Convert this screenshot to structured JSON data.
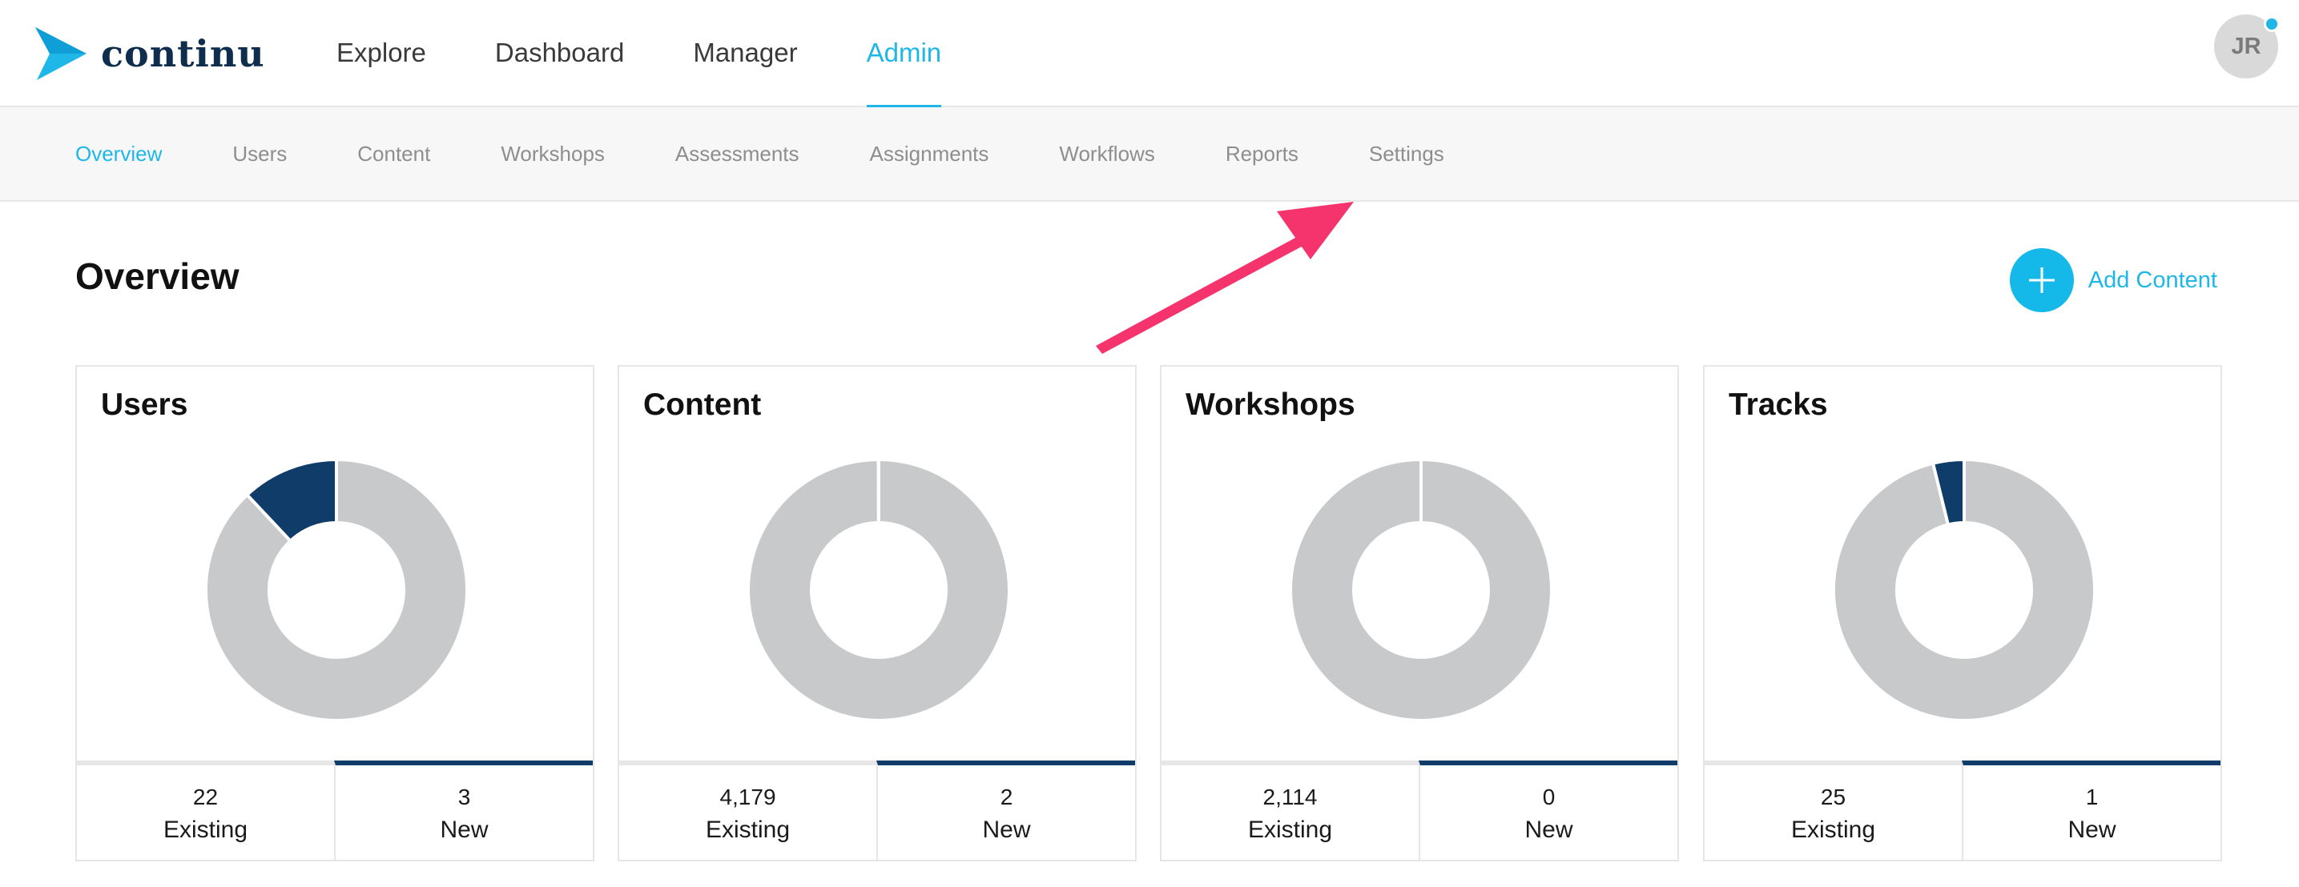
{
  "app": {
    "logo_text": "continu"
  },
  "main_nav": [
    {
      "label": "Explore",
      "active": false
    },
    {
      "label": "Dashboard",
      "active": false
    },
    {
      "label": "Manager",
      "active": false
    },
    {
      "label": "Admin",
      "active": true
    }
  ],
  "user": {
    "initials": "JR",
    "notification_color": "#1eb7e8"
  },
  "sub_nav": [
    {
      "label": "Overview",
      "active": true
    },
    {
      "label": "Users",
      "active": false
    },
    {
      "label": "Content",
      "active": false
    },
    {
      "label": "Workshops",
      "active": false
    },
    {
      "label": "Assessments",
      "active": false
    },
    {
      "label": "Assignments",
      "active": false
    },
    {
      "label": "Workflows",
      "active": false
    },
    {
      "label": "Reports",
      "active": false
    },
    {
      "label": "Settings",
      "active": false
    }
  ],
  "page": {
    "title": "Overview",
    "add_button_label": "Add Content",
    "add_icon": "plus-icon"
  },
  "colors": {
    "accent": "#1eb7e8",
    "existing": "#c8c9ca",
    "new": "#0f3c68",
    "annotation_arrow": "#f5336c"
  },
  "cards": [
    {
      "title": "Users",
      "existing_value": "22",
      "existing_label": "Existing",
      "new_value": "3",
      "new_label": "New",
      "existing": 22,
      "new": 3
    },
    {
      "title": "Content",
      "existing_value": "4,179",
      "existing_label": "Existing",
      "new_value": "2",
      "new_label": "New",
      "existing": 4179,
      "new": 2
    },
    {
      "title": "Workshops",
      "existing_value": "2,114",
      "existing_label": "Existing",
      "new_value": "0",
      "new_label": "New",
      "existing": 2114,
      "new": 0
    },
    {
      "title": "Tracks",
      "existing_value": "25",
      "existing_label": "Existing",
      "new_value": "1",
      "new_label": "New",
      "existing": 25,
      "new": 1
    }
  ],
  "annotation": {
    "icon": "arrow-pointing-to-settings"
  }
}
